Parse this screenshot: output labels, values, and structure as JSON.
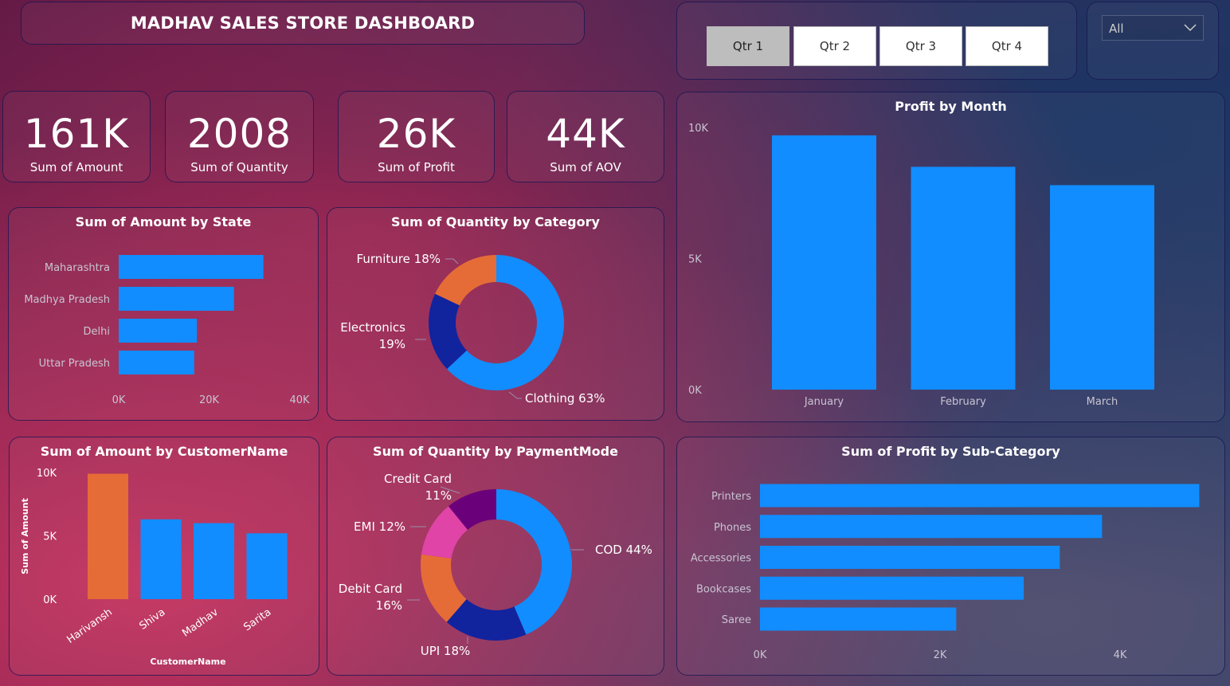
{
  "header": {
    "title": "MADHAV SALES STORE DASHBOARD"
  },
  "quarter_slicer": {
    "buttons": [
      "Qtr 1",
      "Qtr 2",
      "Qtr 3",
      "Qtr 4"
    ],
    "selected": "Qtr 1"
  },
  "filter_dropdown": {
    "value": "All"
  },
  "kpis": [
    {
      "value": "161K",
      "label": "Sum of Amount"
    },
    {
      "value": "2008",
      "label": "Sum of Quantity"
    },
    {
      "value": "26K",
      "label": "Sum of Profit"
    },
    {
      "value": "44K",
      "label": "Sum of AOV"
    }
  ],
  "colors": {
    "bar": "#118dff",
    "highlight": "#e66c37",
    "navy": "#12239e",
    "purple": "#6b007b",
    "pink": "#e044a7"
  },
  "chart_data": [
    {
      "id": "amount_by_state",
      "type": "bar",
      "orientation": "horizontal",
      "title": "Sum of Amount by State",
      "categories": [
        "Maharashtra",
        "Madhya Pradesh",
        "Delhi",
        "Uttar Pradesh"
      ],
      "values": [
        32000,
        25500,
        17300,
        16700
      ],
      "xlim": [
        0,
        40000
      ],
      "ticks": [
        "0K",
        "20K",
        "40K"
      ]
    },
    {
      "id": "quantity_by_category",
      "type": "pie",
      "donut": true,
      "title": "Sum of Quantity by Category",
      "slices": [
        {
          "name": "Clothing",
          "value": 63,
          "label": "Clothing 63%"
        },
        {
          "name": "Electronics",
          "value": 19,
          "label": "Electronics 19%"
        },
        {
          "name": "Furniture",
          "value": 18,
          "label": "Furniture 18%"
        }
      ]
    },
    {
      "id": "profit_by_month",
      "type": "bar",
      "title": "Profit by Month",
      "categories": [
        "January",
        "February",
        "March"
      ],
      "values": [
        9700,
        8500,
        7800
      ],
      "ylim": [
        0,
        10000
      ],
      "ticks": [
        "0K",
        "5K",
        "10K"
      ]
    },
    {
      "id": "amount_by_customer",
      "type": "bar",
      "title": "Sum of Amount by CustomerName",
      "xlabel": "CustomerName",
      "ylabel": "Sum of Amount",
      "categories": [
        "Harivansh",
        "Shiva",
        "Madhav",
        "Sarita"
      ],
      "values": [
        9900,
        6300,
        6000,
        5200
      ],
      "highlight_index": 0,
      "ylim": [
        0,
        10000
      ],
      "ticks": [
        "0K",
        "5K",
        "10K"
      ]
    },
    {
      "id": "quantity_by_payment",
      "type": "pie",
      "donut": true,
      "title": "Sum of Quantity by PaymentMode",
      "slices": [
        {
          "name": "COD",
          "value": 44,
          "label": "COD 44%"
        },
        {
          "name": "UPI",
          "value": 18,
          "label": "UPI 18%"
        },
        {
          "name": "Debit Card",
          "value": 16,
          "label": "Debit Card 16%"
        },
        {
          "name": "EMI",
          "value": 12,
          "label": "EMI 12%"
        },
        {
          "name": "Credit Card",
          "value": 11,
          "label": "Credit Card 11%"
        }
      ]
    },
    {
      "id": "profit_by_subcategory",
      "type": "bar",
      "orientation": "horizontal",
      "title": "Sum of Profit by Sub-Category",
      "categories": [
        "Printers",
        "Phones",
        "Accessories",
        "Bookcases",
        "Saree"
      ],
      "values": [
        4900,
        3800,
        3330,
        2930,
        2180
      ],
      "xlim": [
        0,
        4000
      ],
      "ticks": [
        "0K",
        "2K",
        "4K"
      ]
    }
  ]
}
